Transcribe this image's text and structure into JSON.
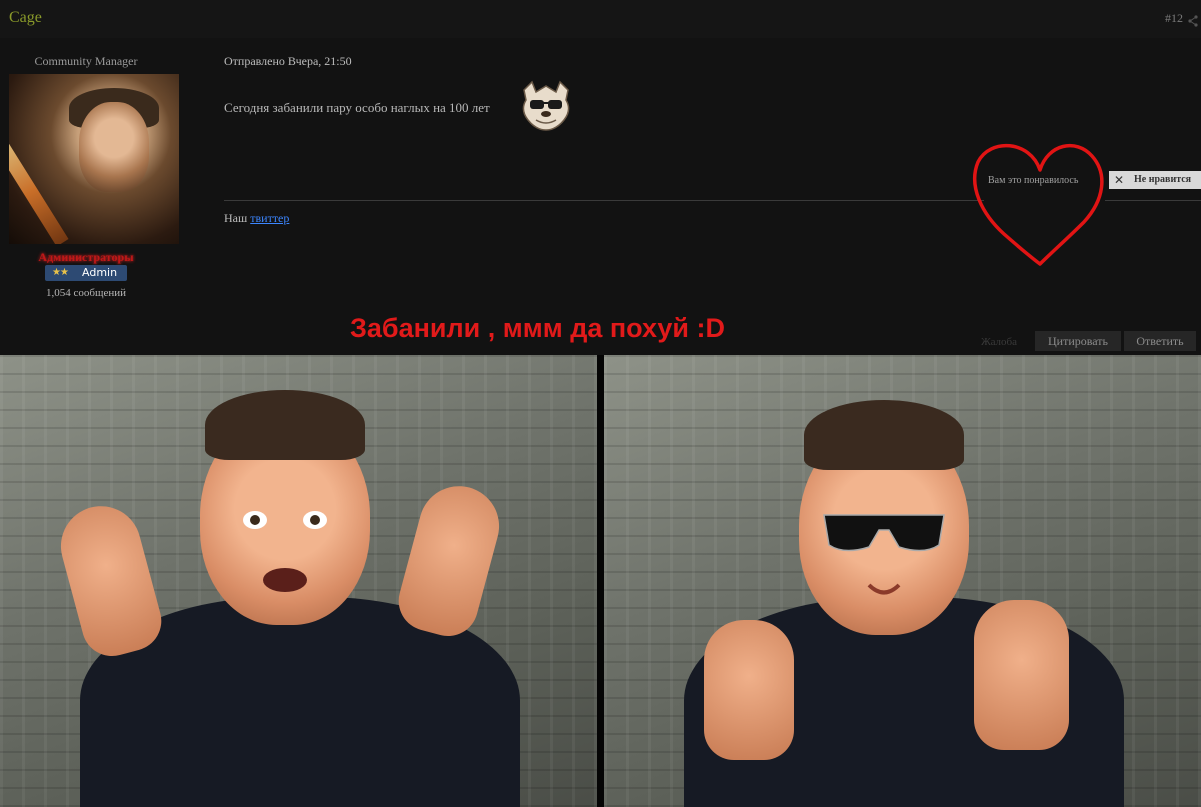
{
  "header": {
    "author": "Cage",
    "post_number": "#12"
  },
  "user": {
    "rank": "Community Manager",
    "group": "Администраторы",
    "badge_stars": "★★",
    "badge_label": "Admin",
    "message_count": "1,054 сообщений"
  },
  "post": {
    "meta": "Отправлено Вчера, 21:50",
    "text": "Сегодня забанили пару особо наглых на 100 лет",
    "like_text": "Вам это понравилось",
    "dislike_label": "Не нравится",
    "signature_prefix": "Наш ",
    "signature_link": "твиттер"
  },
  "annotation": {
    "text": "Забанили , ммм да похуй :D",
    "color": "#e11a1a"
  },
  "actions": {
    "report": "Жалоба",
    "quote": "Цитировать",
    "reply": "Ответить"
  },
  "colors": {
    "author": "#8a9a2a",
    "admin_badge": "#2d4a73",
    "link": "#3c86ff"
  }
}
